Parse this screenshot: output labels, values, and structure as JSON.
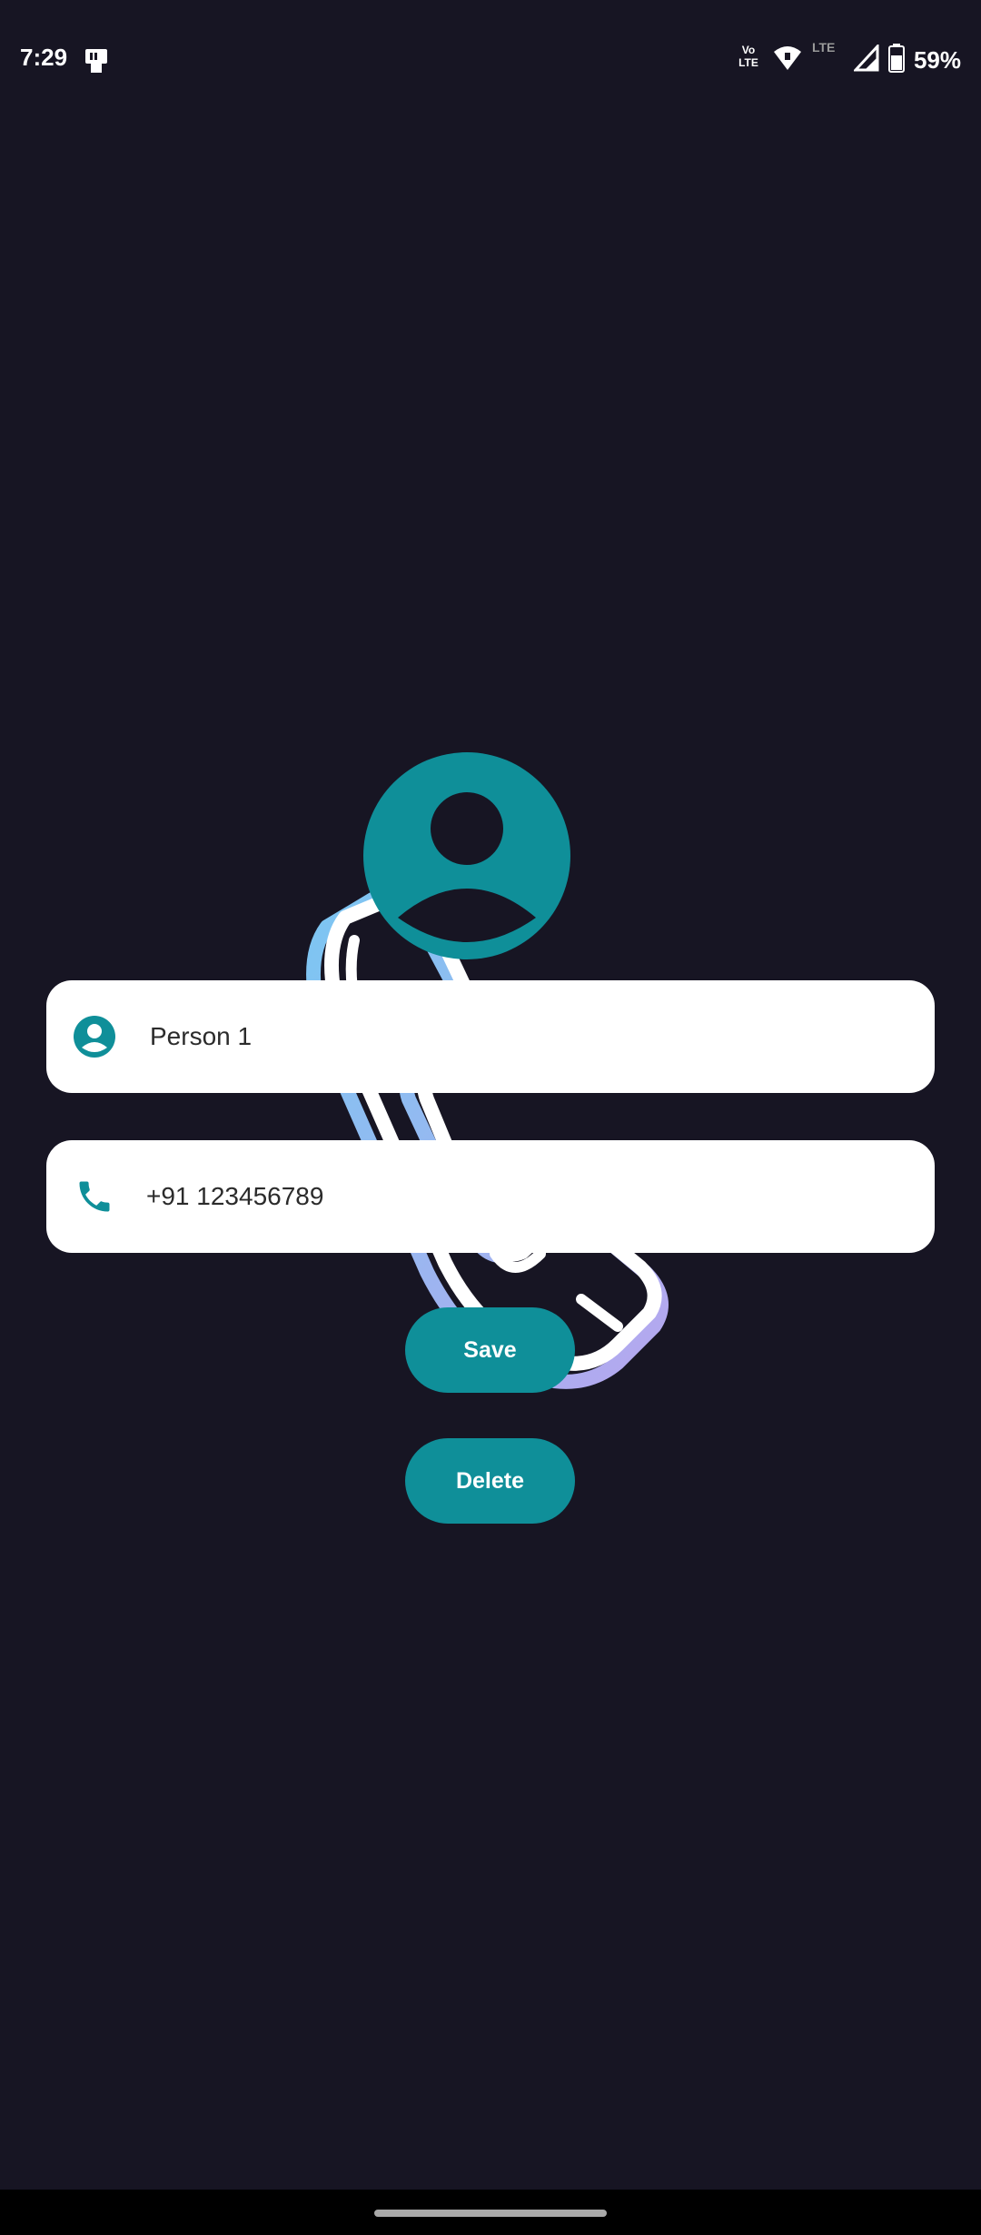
{
  "status_bar": {
    "time": "7:29",
    "volte_line1": "Vo",
    "volte_line2": "LTE",
    "lte_label": "LTE",
    "battery_percent": "59%",
    "icons": [
      "notification-icon",
      "volte-icon",
      "wifi-icon",
      "lte-icon",
      "signal-icon",
      "battery-icon"
    ]
  },
  "contact_form": {
    "name_value": "Person 1",
    "phone_value": "+91 123456789",
    "name_icon": "person-circle-icon",
    "phone_icon": "phone-icon"
  },
  "actions": {
    "save_label": "Save",
    "delete_label": "Delete"
  },
  "colors": {
    "background": "#171523",
    "accent": "#0f8f99",
    "card": "#ffffff"
  }
}
